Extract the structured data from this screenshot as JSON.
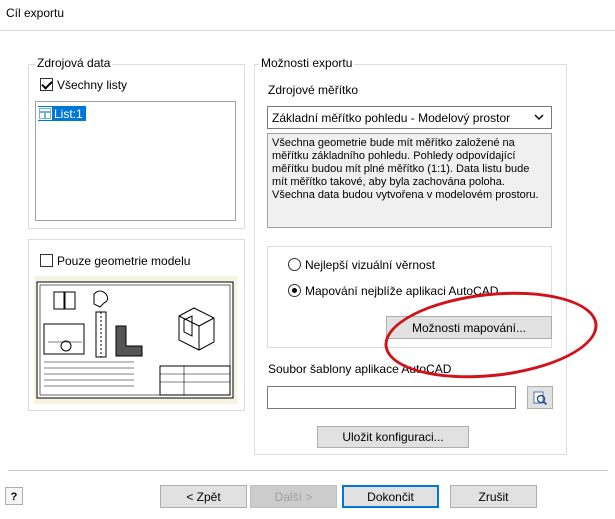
{
  "window": {
    "title": "Cíl exportu"
  },
  "source": {
    "legend": "Zdrojová data",
    "all_sheets_label": "Všechny listy",
    "all_sheets_checked": true,
    "sheets": [
      {
        "label": "List:1"
      }
    ]
  },
  "preview": {
    "model_only_label": "Pouze geometrie modelu",
    "model_only_checked": false
  },
  "export_options": {
    "legend": "Možnosti exportu",
    "scale_label": "Zdrojové měřítko",
    "scale_value": "Základní měřítko pohledu - Modelový prostor",
    "description": "Všechna geometrie bude mít měřítko založené na měřítku základního pohledu. Pohledy odpovídající měřítku budou mít plné měřítko (1:1). Data listu bude mít měřítko takové, aby byla zachována poloha. Všechna data budou vytvořena v modelovém prostoru.",
    "radio_best_visual": "Nejlepší vizuální věrnost",
    "radio_closest_mapping": "Mapování nejblíže aplikaci AutoCAD",
    "selected_radio": "closest_mapping",
    "mapping_options_button": "Možnosti mapování...",
    "template_label": "Soubor šablony aplikace AutoCAD",
    "template_value": "",
    "save_config_button": "Uložit konfiguraci..."
  },
  "footer": {
    "help_icon": "help-icon",
    "back_button": "< Zpět",
    "next_button": "Další >",
    "finish_button": "Dokončit",
    "cancel_button": "Zrušit"
  },
  "colors": {
    "accent": "#0078d7",
    "annotation_red": "#d0121b"
  }
}
